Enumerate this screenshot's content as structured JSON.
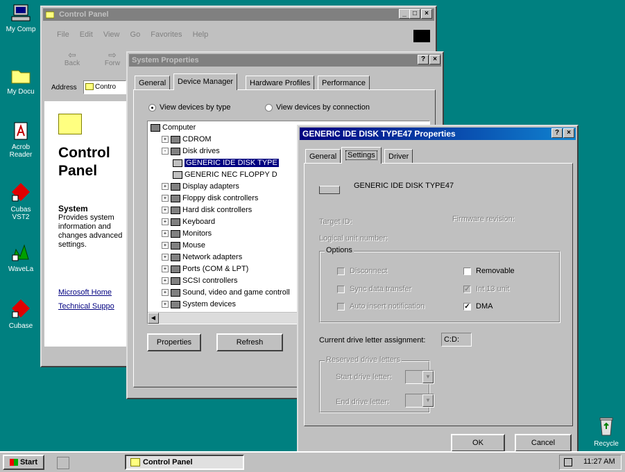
{
  "colors": {
    "desktop": "#008080",
    "title_active": "#000080",
    "selection": "#000080"
  },
  "desktop_icons": [
    {
      "label": "My Comp",
      "icon": "computer-icon"
    },
    {
      "label": "My Docu",
      "icon": "folder-icon"
    },
    {
      "label": "Acrob Reader",
      "icon": "acrobat-icon"
    },
    {
      "label": "Cubas VST2",
      "icon": "cubase-icon"
    },
    {
      "label": "WaveLa",
      "icon": "wavelab-icon"
    },
    {
      "label": "Cubase",
      "icon": "cubase-icon"
    },
    {
      "label": "Recycle",
      "icon": "recycle-bin-icon"
    }
  ],
  "control_panel": {
    "title": "Control Panel",
    "menu": [
      "File",
      "Edit",
      "View",
      "Go",
      "Favorites",
      "Help"
    ],
    "toolbar": {
      "back": "Back",
      "forward": "Forw"
    },
    "address_label": "Address",
    "address_value": "Contro",
    "heading": "Control Panel",
    "system_title": "System",
    "system_desc": "Provides system information and changes advanced settings.",
    "links": [
      "Microsoft Home",
      "Technical Suppo"
    ]
  },
  "system_props": {
    "title": "System Properties",
    "tabs": [
      "General",
      "Device Manager",
      "Hardware Profiles",
      "Performance"
    ],
    "radio_type": "View devices by type",
    "radio_connection": "View devices by connection",
    "tree": [
      {
        "label": "Computer",
        "level": 0,
        "exp": ""
      },
      {
        "label": "CDROM",
        "level": 1,
        "exp": "+"
      },
      {
        "label": "Disk drives",
        "level": 1,
        "exp": "-"
      },
      {
        "label": "GENERIC IDE  DISK TYPE",
        "level": 2,
        "exp": ""
      },
      {
        "label": "GENERIC NEC  FLOPPY D",
        "level": 2,
        "exp": ""
      },
      {
        "label": "Display adapters",
        "level": 1,
        "exp": "+"
      },
      {
        "label": "Floppy disk controllers",
        "level": 1,
        "exp": "+"
      },
      {
        "label": "Hard disk controllers",
        "level": 1,
        "exp": "+"
      },
      {
        "label": "Keyboard",
        "level": 1,
        "exp": "+"
      },
      {
        "label": "Monitors",
        "level": 1,
        "exp": "+"
      },
      {
        "label": "Mouse",
        "level": 1,
        "exp": "+"
      },
      {
        "label": "Network adapters",
        "level": 1,
        "exp": "+"
      },
      {
        "label": "Ports (COM & LPT)",
        "level": 1,
        "exp": "+"
      },
      {
        "label": "SCSI controllers",
        "level": 1,
        "exp": "+"
      },
      {
        "label": "Sound, video and game controll",
        "level": 1,
        "exp": "+"
      },
      {
        "label": "System devices",
        "level": 1,
        "exp": "+"
      }
    ],
    "btn_properties": "Properties",
    "btn_refresh": "Refresh"
  },
  "disk_props": {
    "title": "GENERIC IDE  DISK TYPE47 Properties",
    "tabs": [
      "General",
      "Settings",
      "Driver"
    ],
    "device_name": "GENERIC IDE  DISK TYPE47",
    "target_id": "Target ID:",
    "firmware": "Firmware revision:",
    "lun": "Logical unit number:",
    "options_label": "Options",
    "options": [
      {
        "label": "Disconnect",
        "checked": false,
        "disabled": true
      },
      {
        "label": "Sync data transfer",
        "checked": false,
        "disabled": true
      },
      {
        "label": "Auto insert notification",
        "checked": false,
        "disabled": true
      },
      {
        "label": "Removable",
        "checked": false,
        "disabled": false
      },
      {
        "label": "Int 13 unit",
        "checked": true,
        "disabled": true
      },
      {
        "label": "DMA",
        "checked": true,
        "disabled": false
      }
    ],
    "drive_letter_label": "Current drive letter assignment:",
    "drive_letter_value": "C:D:",
    "reserved_label": "Reserved drive letters",
    "start_label": "Start drive letter:",
    "end_label": "End drive letter:",
    "ok": "OK",
    "cancel": "Cancel"
  },
  "taskbar": {
    "start": "Start",
    "task": "Control Panel",
    "time": "11:27 AM"
  }
}
